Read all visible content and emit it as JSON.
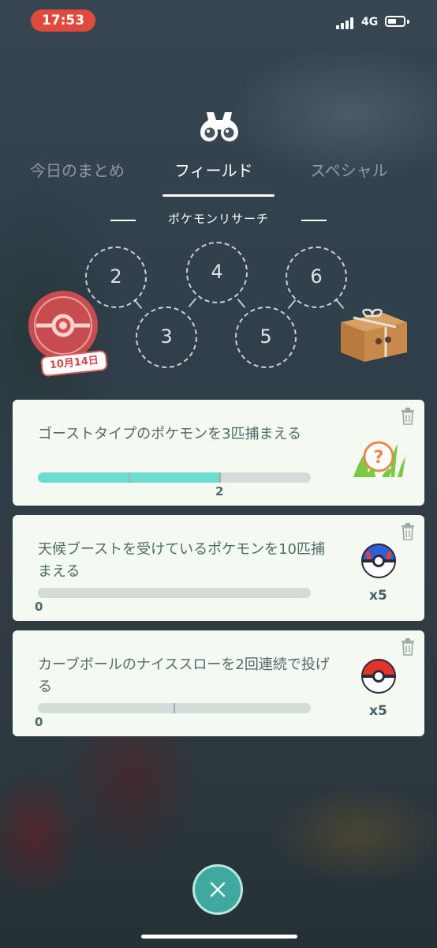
{
  "status_bar": {
    "time": "17:53",
    "network": "4G"
  },
  "tabs": [
    {
      "label": "今日のまとめ",
      "active": false
    },
    {
      "label": "フィールド",
      "active": true
    },
    {
      "label": "スペシャル",
      "active": false
    }
  ],
  "section_title": "ポケモンリサーチ",
  "stages": [
    "2",
    "3",
    "4",
    "5",
    "6"
  ],
  "stamp": {
    "date": "10月14日"
  },
  "tasks": [
    {
      "text": "ゴーストタイプのポケモンを3匹捕まえる",
      "progress_value": "2",
      "progress_fraction": 0.6667,
      "reward_icon": "unknown-pokemon-encounter-icon",
      "reward_count": ""
    },
    {
      "text": "天候ブーストを受けているポケモンを10匹捕まえる",
      "progress_value": "0",
      "progress_fraction": 0,
      "reward_icon": "great-ball-icon",
      "reward_count": "x5"
    },
    {
      "text": "カーブボールのナイススローを2回連続で投げる",
      "progress_value": "0",
      "progress_fraction": 0,
      "reward_icon": "poke-ball-icon",
      "reward_count": "x5"
    }
  ],
  "colors": {
    "accent": "#6ddcd0",
    "close_button": "#3fa99f",
    "status_time_bg": "#e0493c",
    "card_bg": "#f4faf2"
  }
}
